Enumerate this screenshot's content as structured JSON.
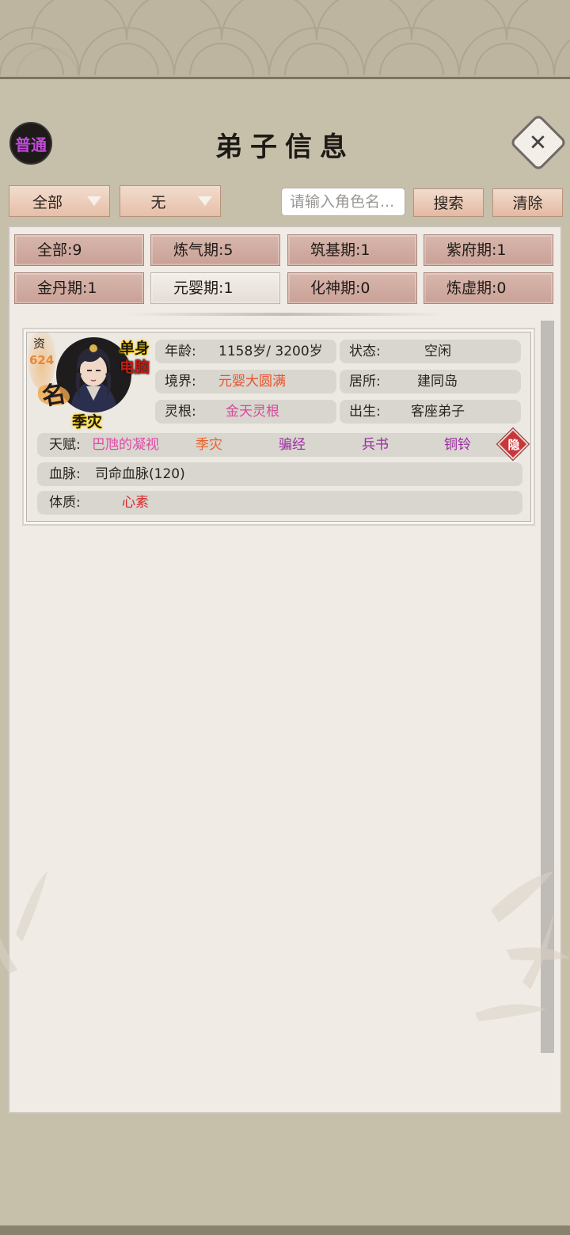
{
  "header": {
    "mode_badge": "普通",
    "title": "弟子信息",
    "close_icon": "close-icon"
  },
  "filters": {
    "category": {
      "selected": "全部"
    },
    "secondary": {
      "selected": "无"
    },
    "search": {
      "placeholder": "请输入角色名...",
      "value": ""
    },
    "search_button": "搜索",
    "clear_button": "清除"
  },
  "stages": [
    {
      "label": "全部:9",
      "selected": false
    },
    {
      "label": "炼气期:5",
      "selected": false
    },
    {
      "label": "筑基期:1",
      "selected": false
    },
    {
      "label": "紫府期:1",
      "selected": false
    },
    {
      "label": "金丹期:1",
      "selected": false
    },
    {
      "label": "元婴期:1",
      "selected": true
    },
    {
      "label": "化神期:0",
      "selected": false
    },
    {
      "label": "炼虚期:0",
      "selected": false
    }
  ],
  "disciple": {
    "aptitude_label": "资",
    "aptitude_value": "624",
    "fame_mark": "名",
    "tag_single": "单身",
    "tag_pc": "电脑",
    "name": "季灾",
    "age": {
      "key": "年龄:",
      "value": "1158岁/ 3200岁"
    },
    "status": {
      "key": "状态:",
      "value": "空闲"
    },
    "realm": {
      "key": "境界:",
      "value": "元婴大圆满",
      "color": "#e8542c"
    },
    "residence": {
      "key": "居所:",
      "value": "建同岛"
    },
    "spirit_root": {
      "key": "灵根:",
      "value": "金天灵根",
      "color": "#d9489b"
    },
    "origin": {
      "key": "出生:",
      "value": "客座弟子"
    },
    "talents": {
      "key": "天赋:",
      "items": [
        {
          "text": "巴虺的凝视",
          "color": "#de4ba6"
        },
        {
          "text": "季灾",
          "color": "#e8632a"
        },
        {
          "text": "骗经",
          "color": "#9b2aa3"
        },
        {
          "text": "兵书",
          "color": "#9b2aa3"
        },
        {
          "text": "铜铃",
          "color": "#9b2aa3"
        }
      ],
      "hide_label": "隐"
    },
    "bloodline": {
      "key": "血脉:",
      "value": "司命血脉(120)"
    },
    "physique": {
      "key": "体质:",
      "value": "心素",
      "color": "#d42a2a"
    }
  },
  "colors": {
    "button_bg": "#e6bfa9",
    "stage_bg": "#c9a096",
    "panel_bg": "#f0ebe4",
    "accent_purple": "#c04ad6"
  }
}
